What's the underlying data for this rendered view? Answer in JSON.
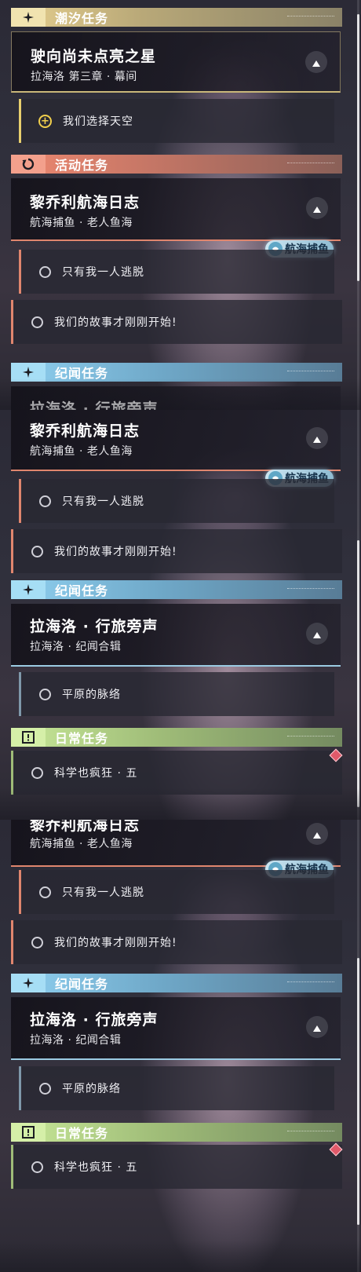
{
  "sections": {
    "tide": {
      "title": "潮汐任务",
      "color": "#e6cf8e"
    },
    "event": {
      "title": "活动任务",
      "color": "#ee8870"
    },
    "story": {
      "title": "纪闻任务",
      "color": "#8fd0f0"
    },
    "daily": {
      "title": "日常任务",
      "color": "#c8e898"
    }
  },
  "quests": {
    "tide_main": {
      "title": "驶向尚未点亮之星",
      "subtitle": "拉海洛 第三章 · 幕间"
    },
    "event_main": {
      "title": "黎乔利航海日志",
      "subtitle": "航海捕鱼 · 老人鱼海"
    },
    "story_main": {
      "title": "拉海洛 · 行旅旁声",
      "subtitle": "拉海洛 · 纪闻合辑"
    }
  },
  "objectives": {
    "tide_selected": "我们选择天空",
    "event_a": "只有我一人逃脱",
    "event_b": "我们的故事才刚刚开始!",
    "story_a": "平原的脉络",
    "daily_a": "科学也疯狂 · 五"
  },
  "tag": {
    "label": "航海捕鱼"
  },
  "icons": {
    "tide": "sparkle-icon",
    "event": "refresh-icon",
    "story": "sparkle-icon",
    "daily": "exclamation-box-icon",
    "collapse": "triangle-up-icon",
    "objective": "circle-icon",
    "tracked": "plus-circle-icon",
    "tag": "fishing-icon",
    "alert": "diamond-icon"
  },
  "colors": {
    "selected_accent": "#f1cf4c",
    "alert": "#e05a6a"
  }
}
